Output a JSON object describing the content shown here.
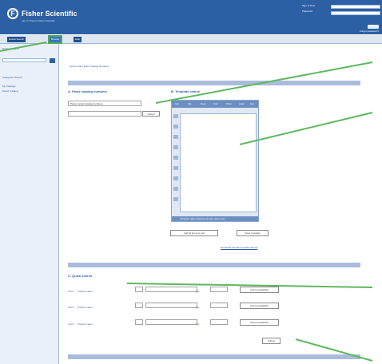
{
  "header": {
    "brand": "Fisher Scientific",
    "tagline": "part of Thermo Fisher Scientific",
    "signin_label_1": "Sign In Now",
    "signin_label_2": "Password",
    "signin_button": "Go",
    "forgot_link": "Forgot password?"
  },
  "tabs": [
    {
      "label": "Global Search"
    },
    {
      "label": "Browse"
    },
    {
      "label": "Help"
    }
  ],
  "sidebar": {
    "product_search": "Product Search",
    "category_search": "Categories Search",
    "catalog_link": "My Catalogs",
    "catalog_link_2": "Select Catalog"
  },
  "main": {
    "breadcrumb": "Quick Order: Enter Catalog Numbers",
    "section_a": "A. Paste catalog numbers",
    "section_b": "B. Template search",
    "section_c": "C. Quick search",
    "paste_select": "Paste copied catalog numbers",
    "submit_a": "Submit",
    "add_to_cart": "Add all items to cart",
    "clear_template": "Clear template",
    "template_link": "Download sample template (Excel)",
    "row_1_prefix": "Cat #",
    "row_1_label": "Product name",
    "row_2_prefix": "Cat #",
    "row_2_label": "Product name",
    "row_3_prefix": "Cat #",
    "row_3_label": "Product name",
    "qty_sep": "Qty",
    "item_btn_1": "Check Availability",
    "item_btn_2": "Check Availability",
    "item_btn_3": "Check Availability",
    "submit_c": "Submit"
  },
  "template": {
    "headers": [
      "Cat",
      "Qty",
      "Desc",
      "Unit",
      "Price",
      "Avail",
      "Del"
    ],
    "footer": "Template table showing sample order lines"
  }
}
